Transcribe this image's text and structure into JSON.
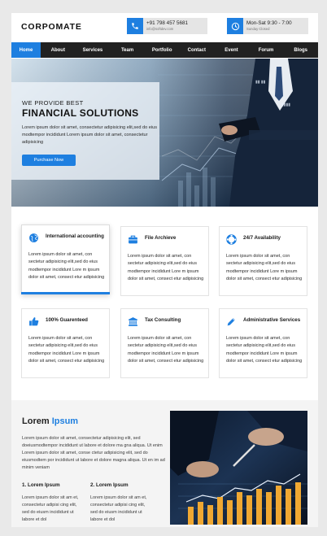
{
  "header": {
    "logo": "CORPOMATE",
    "phone": {
      "icon": "phone-icon",
      "primary": "+91 798 457 5681",
      "secondary": "info@softdev.com"
    },
    "hours": {
      "icon": "clock-icon",
      "primary": "Mon-Sat 9:30 - 7:00",
      "secondary": "Sunday Closed"
    }
  },
  "nav": {
    "items": [
      "Home",
      "About",
      "Services",
      "Team",
      "Portfolio",
      "Contact",
      "Event",
      "Forum",
      "Blogs"
    ],
    "active": "Home"
  },
  "hero": {
    "pretitle": "WE PROVIDE BEST",
    "title": "FINANCIAL SOLUTIONS",
    "text": "Lorem ipsum dolor sit amet, consectetur adipisicing elit,sed do eius modtempor incididunt Lorem ipsum dolor sit amet, consectetur adipisicing",
    "button": "Purchase Now"
  },
  "services": [
    {
      "icon": "globe-icon",
      "title": "International accounting",
      "text": "Lorem ipsum dolor sit amet, con sectetur adipisicing elit,sed do eius modtempor incididunt Lore m ipsum dolor sit amet, consect etur adipisicing",
      "featured": true
    },
    {
      "icon": "briefcase-icon",
      "title": "File Archieve",
      "text": "Lorem ipsum dolor sit amet, con sectetur adipisicing elit,sed do eius modtempor incididunt Lore m ipsum dolor sit amet, consect etur adipisicing",
      "featured": false
    },
    {
      "icon": "lifebuoy-icon",
      "title": "24/7 Availability",
      "text": "Lorem ipsum dolor sit amet, con sectetur adipisicing elit,sed do eius modtempor incididunt Lore m ipsum dolor sit amet, consect etur adipisicing",
      "featured": false
    },
    {
      "icon": "thumbs-up-icon",
      "title": "100% Guarenteed",
      "text": "Lorem ipsum dolor sit amet, con sectetur adipisicing elit,sed do eius modtempor incididunt Lore m ipsum dolor sit amet, consect etur adipisicing",
      "featured": false
    },
    {
      "icon": "bank-icon",
      "title": "Tax Consulting",
      "text": "Lorem ipsum dolor sit amet, con sectetur adipisicing elit,sed do eius modtempor incididunt Lore m ipsum dolor sit amet, consect etur adipisicing",
      "featured": false
    },
    {
      "icon": "pencil-icon",
      "title": "Administrative Services",
      "text": "Lorem ipsum dolor sit amet, con sectetur adipisicing elit,sed do eius modtempor incididunt Lore m ipsum dolor sit amet, consect etur adipisicing",
      "featured": false
    }
  ],
  "about": {
    "heading_a": "Lorem",
    "heading_b": "Ipsum",
    "text": "Lorem ipsum dolor sit amet, consectetur adipisicing elit, sed doeiusmodtempor incididunt ut labore et dolore ma gna aliqua. Ut enim Lorem ipsum dolor sit amet, conse ctetur adipisicing elit, sed do eiusmodtem por incididunt ut labore et dolore magna aliqua. Ut en im ad minim veniam",
    "points": [
      {
        "title": "1. Lorem Ipsum",
        "text": "Lorem ipsum dolor sit am et, consectetur adipisi cing elit, sed do eiusm incididunt ut labore et dol"
      },
      {
        "title": "2. Lorem Ipsum",
        "text": "Lorem ipsum dolor sit am et, consectetur adipisi cing elit, sed do eiusm incididunt ut labore et dol"
      }
    ]
  },
  "colors": {
    "accent": "#1e7fe0",
    "nav_bg": "#212121",
    "hero_overlay": "#ebf2f8"
  }
}
